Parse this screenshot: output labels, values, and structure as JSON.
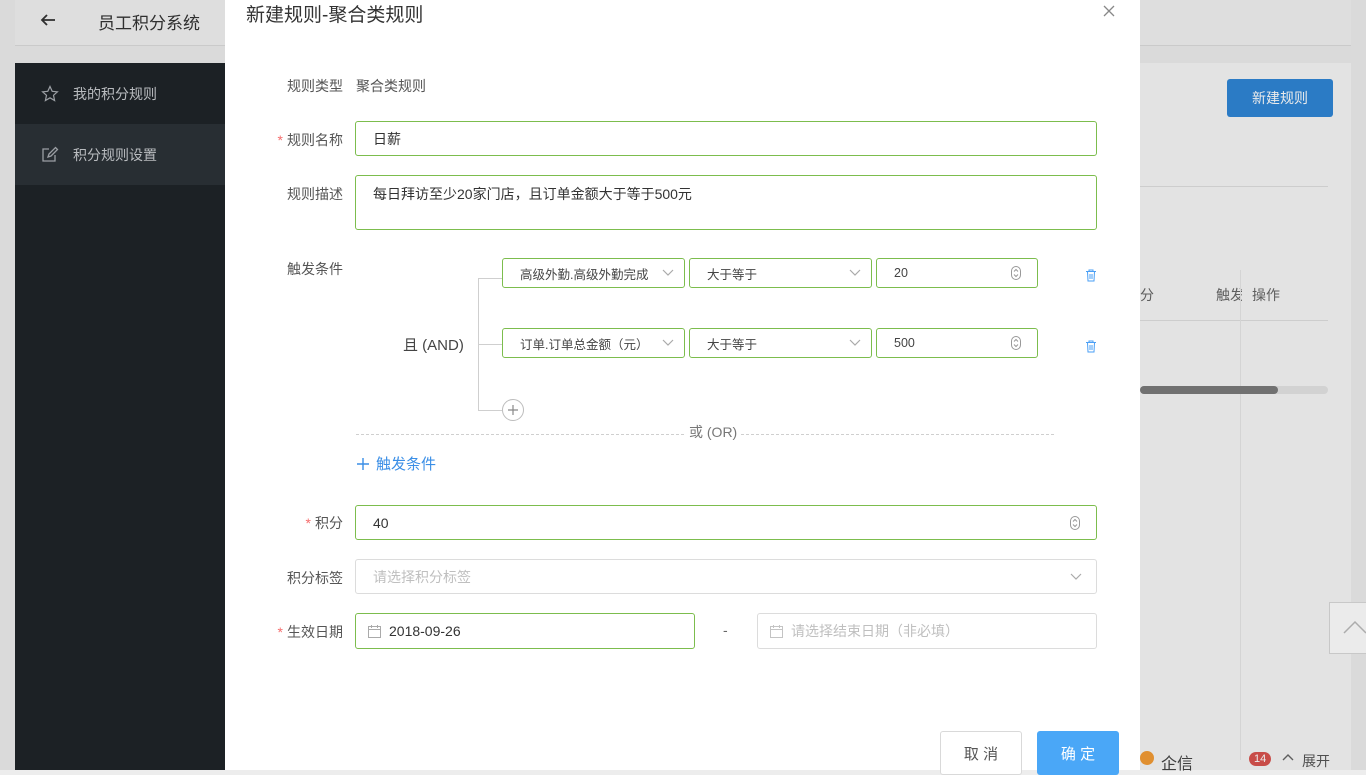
{
  "app": {
    "title": "员工积分系统"
  },
  "sidebar": {
    "items": [
      {
        "label": "我的积分规则",
        "icon": "star-icon"
      },
      {
        "label": "积分规则设置",
        "icon": "edit-icon"
      }
    ]
  },
  "background": {
    "new_rule_button": "新建规则",
    "table_headers": [
      "分",
      "触发",
      "操作"
    ]
  },
  "floating": {
    "qixin": "企信",
    "badge": "14",
    "expand": "展开"
  },
  "dialog": {
    "title": "新建规则-聚合类规则",
    "rule_type": {
      "label": "规则类型",
      "value": "聚合类规则"
    },
    "rule_name": {
      "label": "规则名称",
      "value": "日薪"
    },
    "rule_desc": {
      "label": "规则描述",
      "value": "每日拜访至少20家门店，且订单金额大于等于500元"
    },
    "trigger": {
      "label": "触发条件",
      "group_operator": "且 (AND)",
      "conditions": [
        {
          "field": "高级外勤.高级外勤完成",
          "operator": "大于等于",
          "value": "20"
        },
        {
          "field": "订单.订单总金额（元）",
          "operator": "大于等于",
          "value": "500"
        }
      ],
      "or_label": "或 (OR)",
      "add_label": "触发条件"
    },
    "points": {
      "label": "积分",
      "value": "40"
    },
    "tags": {
      "label": "积分标签",
      "placeholder": "请选择积分标签"
    },
    "effective": {
      "label": "生效日期",
      "start": "2018-09-26",
      "separator": "-",
      "end_placeholder": "请选择结束日期（非必填）"
    },
    "cancel_label": "取 消",
    "confirm_label": "确 定"
  }
}
